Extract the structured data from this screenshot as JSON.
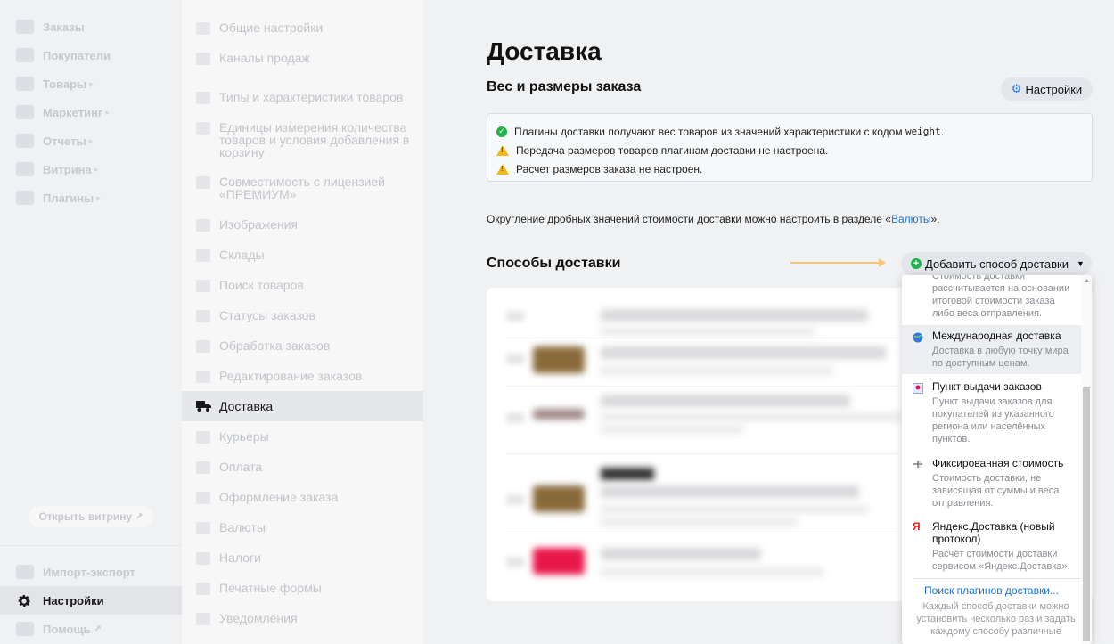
{
  "sidebar": {
    "items": [
      {
        "label": "Заказы",
        "icon": "cart-icon",
        "submenu": false
      },
      {
        "label": "Покупатели",
        "icon": "users-icon",
        "submenu": false
      },
      {
        "label": "Товары",
        "icon": "box-icon",
        "submenu": true
      },
      {
        "label": "Маркетинг",
        "icon": "megaphone-icon",
        "submenu": true
      },
      {
        "label": "Отчеты",
        "icon": "chart-icon",
        "submenu": true
      },
      {
        "label": "Витрина",
        "icon": "storefront-icon",
        "submenu": true
      },
      {
        "label": "Плагины",
        "icon": "puzzle-icon",
        "submenu": true
      }
    ],
    "storefront_button": "Открыть витрину",
    "bottom_items": [
      {
        "label": "Импорт-экспорт",
        "icon": "import-export-icon"
      },
      {
        "label": "Настройки",
        "icon": "gear-icon"
      },
      {
        "label": "Помощь",
        "icon": "help-icon"
      }
    ]
  },
  "settings_menu": {
    "items": [
      {
        "label": "Общие настройки",
        "icon": "list-icon"
      },
      {
        "label": "Каналы продаж",
        "icon": "cart-icon"
      },
      {
        "label": "Типы и характеристики товаров",
        "icon": "list-icon"
      },
      {
        "label": "Единицы измерения количества товаров и условия добавления в корзину",
        "icon": "list-icon"
      },
      {
        "label": "Совместимость с лицензией «ПРЕМИУМ»",
        "icon": "puzzle-icon"
      },
      {
        "label": "Изображения",
        "icon": "camera-icon"
      },
      {
        "label": "Склады",
        "icon": "warehouse-icon"
      },
      {
        "label": "Поиск товаров",
        "icon": "search-icon"
      },
      {
        "label": "Статусы заказов",
        "icon": "flag-icon"
      },
      {
        "label": "Обработка заказов",
        "icon": "refresh-icon"
      },
      {
        "label": "Редактирование заказов",
        "icon": "edit-icon"
      },
      {
        "label": "Доставка",
        "icon": "truck-icon"
      },
      {
        "label": "Курьеры",
        "icon": "courier-icon"
      },
      {
        "label": "Оплата",
        "icon": "credit-card-icon"
      },
      {
        "label": "Оформление заказа",
        "icon": "checkout-icon"
      },
      {
        "label": "Валюты",
        "icon": "dollar-icon"
      },
      {
        "label": "Налоги",
        "icon": "percent-icon"
      },
      {
        "label": "Печатные формы",
        "icon": "printer-icon"
      },
      {
        "label": "Уведомления",
        "icon": "bell-icon"
      }
    ],
    "active": "Доставка"
  },
  "content": {
    "title": "Доставка",
    "weight_section_title": "Вес и размеры заказа",
    "settings_button": "Настройки",
    "info": {
      "line1_prefix": "Плагины доставки получают вес товаров из значений характеристики с кодом",
      "line1_code": "weight",
      "line1_suffix": ".",
      "line2": "Передача размеров товаров плагинам доставки не настроена.",
      "line3": "Расчет размеров заказа не настроен."
    },
    "rounding_prefix": "Округление дробных значений стоимости доставки можно настроить в разделе «",
    "rounding_link": "Валюты",
    "rounding_suffix": "».",
    "methods_section_title": "Способы доставки",
    "add_method_button": "Добавить способ доставки"
  },
  "dropdown": {
    "partial_desc": "Стоимость доставки рассчитывается на основании итоговой стоимости заказа либо веса отправления.",
    "items": [
      {
        "title": "Международная доставка",
        "desc": "Доставка в любую точку мира по доступным ценам.",
        "icon": "globe-icon"
      },
      {
        "title": "Пункт выдачи заказов",
        "desc": "Пункт выдачи заказов для покупателей из указанного региона или населённых пунктов.",
        "icon": "map-pin-icon"
      },
      {
        "title": "Фиксированная стоимость",
        "desc": "Стоимость доставки, не зависящая от суммы и веса отправления.",
        "icon": "fixed-price-icon"
      },
      {
        "title": "Яндекс.Доставка (новый протокол)",
        "desc": "Расчёт стоимости доставки сервисом «Яндекс.Доставка».",
        "icon": "yandex-icon"
      }
    ],
    "search_link": "Поиск плагинов доставки...",
    "footer": "Каждый способ доставки можно установить несколько раз и задать каждому способу различные"
  },
  "colors": {
    "accent": "#1a73d9",
    "success": "#22b14c",
    "warning": "#f3b81c",
    "arrow": "#f5c37a"
  }
}
